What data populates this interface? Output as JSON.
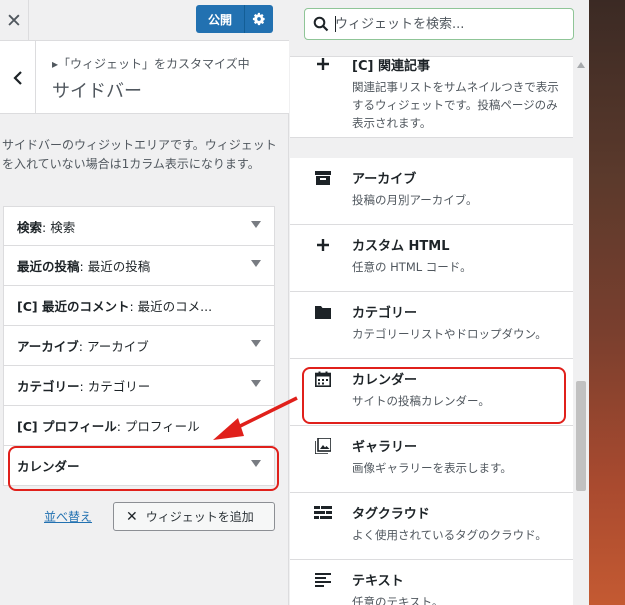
{
  "topbar": {
    "close_symbol": "✕",
    "publish_label": "公開"
  },
  "header": {
    "breadcrumb": "▸「ウィジェット」をカスタマイズ中",
    "title": "サイドバー"
  },
  "description": "サイドバーのウィジットエリアです。ウィジェットを入れていない場合は1カラム表示になります。",
  "sidebar_widgets": [
    {
      "name": "検索",
      "title": ": 検索"
    },
    {
      "name": "最近の投稿",
      "title": ": 最近の投稿"
    },
    {
      "name": "[C] 最近のコメント",
      "title": ": 最近のコメ..."
    },
    {
      "name": "アーカイブ",
      "title": ": アーカイブ"
    },
    {
      "name": "カテゴリー",
      "title": ": カテゴリー"
    },
    {
      "name": "[C] プロフィール",
      "title": ": プロフィール"
    },
    {
      "name": "カレンダー",
      "title": ""
    }
  ],
  "actions": {
    "reorder_label": "並べ替え",
    "add_widget_label": "ウィジェットを追加"
  },
  "search": {
    "placeholder": "ウィジェットを検索..."
  },
  "available_widgets": [
    {
      "icon": "plus-icon",
      "title": "[C] 関連記事",
      "description": "関連記事リストをサムネイルつきで表示するウィジェットです。投稿ページのみ表示されます。"
    },
    {
      "icon": "archive-icon",
      "title": "アーカイブ",
      "description": "投稿の月別アーカイブ。"
    },
    {
      "icon": "plus-icon",
      "title": "カスタム HTML",
      "description": "任意の HTML コード。"
    },
    {
      "icon": "folder-icon",
      "title": "カテゴリー",
      "description": "カテゴリーリストやドロップダウン。"
    },
    {
      "icon": "calendar-icon",
      "title": "カレンダー",
      "description": "サイトの投稿カレンダー。"
    },
    {
      "icon": "gallery-icon",
      "title": "ギャラリー",
      "description": "画像ギャラリーを表示します。"
    },
    {
      "icon": "tag-cloud-icon",
      "title": "タグクラウド",
      "description": "よく使用されているタグのクラウド。"
    },
    {
      "icon": "text-icon",
      "title": "テキスト",
      "description": "任意のテキスト。"
    }
  ],
  "colors": {
    "publish_blue": "#2271b1",
    "highlight_red": "#e0201b",
    "search_border": "#8fc597"
  }
}
